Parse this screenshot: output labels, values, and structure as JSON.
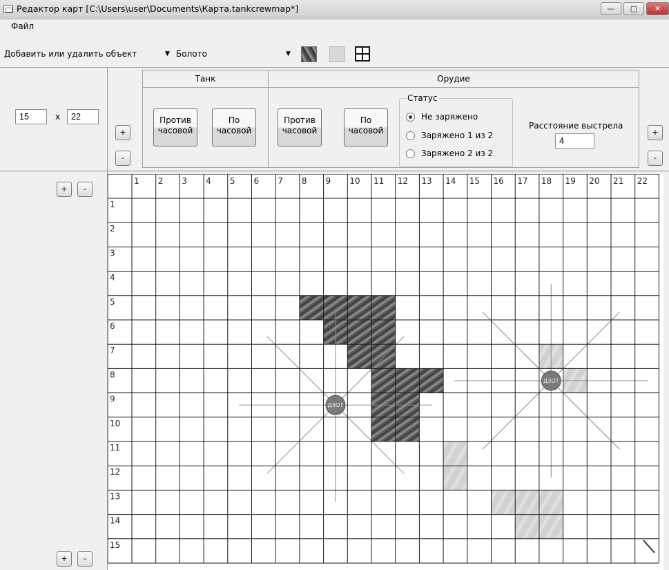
{
  "window": {
    "title": "Редактор карт [C:\\Users\\user\\Documents\\Карта.tankcrewmap*]",
    "controls": [
      "minimize",
      "maximize",
      "close"
    ]
  },
  "menu": {
    "file": "Файл"
  },
  "toolbar": {
    "mode_select": "Добавить или удалить объект",
    "terrain_select": "Болото",
    "swatches": [
      "swamp-texture",
      "light-texture",
      "grid-toggle"
    ]
  },
  "size": {
    "rows": "15",
    "x": "x",
    "cols": "22",
    "plus": "+",
    "minus": "-"
  },
  "tank": {
    "title": "Танк",
    "ccw_line1": "Против",
    "ccw_line2": "часовой",
    "cw_line1": "По",
    "cw_line2": "часовой"
  },
  "gun": {
    "title": "Орудие",
    "ccw_line1": "Против",
    "ccw_line2": "часовой",
    "cw_line1": "По",
    "cw_line2": "часовой",
    "status_title": "Статус",
    "status_options": [
      "Не заряжено",
      "Заряжено 1 из 2",
      "Заряжено 2 из 2"
    ],
    "status_selected": 0,
    "distance_label": "Расстояние выстрела",
    "distance_value": "4"
  },
  "map": {
    "columns": [
      "1",
      "2",
      "3",
      "4",
      "5",
      "6",
      "7",
      "8",
      "9",
      "10",
      "11",
      "12",
      "13",
      "14",
      "15",
      "16",
      "17",
      "18",
      "19",
      "20",
      "21",
      "22"
    ],
    "rows": [
      "1",
      "2",
      "3",
      "4",
      "5",
      "6",
      "7",
      "8",
      "9",
      "10",
      "11",
      "12",
      "13",
      "14",
      "15"
    ],
    "unit_label": "ДЗОТ",
    "bunkers": [
      {
        "label": "ДЗОТ",
        "col": 9,
        "row": 9
      },
      {
        "label": "ДЗОТ",
        "col": 18,
        "row": 8
      }
    ],
    "swamp_cells": [
      [
        8,
        5
      ],
      [
        9,
        5
      ],
      [
        9,
        6
      ],
      [
        10,
        5
      ],
      [
        10,
        6
      ],
      [
        10,
        7
      ],
      [
        11,
        5
      ],
      [
        11,
        6
      ],
      [
        11,
        7
      ],
      [
        11,
        8
      ],
      [
        12,
        8
      ],
      [
        12,
        9
      ],
      [
        13,
        8
      ],
      [
        11,
        9
      ],
      [
        11,
        10
      ],
      [
        12,
        10
      ]
    ],
    "light_cells": [
      [
        14,
        12
      ],
      [
        14,
        11
      ],
      [
        18,
        7
      ],
      [
        19,
        8
      ],
      [
        17,
        13
      ],
      [
        17,
        14
      ],
      [
        18,
        13
      ],
      [
        18,
        14
      ],
      [
        16,
        13
      ]
    ],
    "colors": {
      "swamp": "#5a5a5a",
      "light": "#d2d2d2",
      "bunker": "#7a7a7a",
      "grid": "#1a1a1a"
    }
  }
}
